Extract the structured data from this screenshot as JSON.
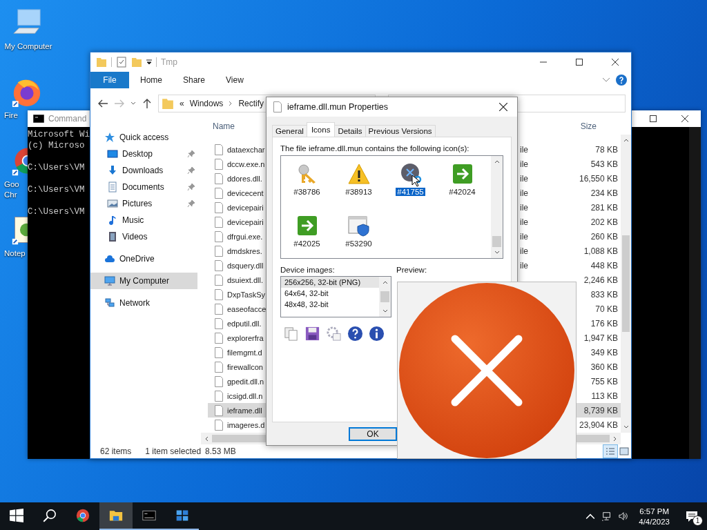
{
  "desktop_icons": [
    {
      "kind": "computer",
      "lines": [
        "My Computer"
      ]
    },
    {
      "kind": "firefox",
      "lines": [
        "Fire"
      ]
    },
    {
      "kind": "chrome",
      "lines": [
        "Goo",
        "Chr"
      ]
    },
    {
      "kind": "notepad",
      "lines": [
        "Notep"
      ]
    }
  ],
  "command_prompt": {
    "title": "Command",
    "lines": [
      {
        "kind": "banner",
        "text": "Microsoft Wi"
      },
      {
        "kind": "banner",
        "text": "(c) Microso"
      },
      {
        "kind": "prompt",
        "text": "C:\\Users\\VM"
      },
      {
        "kind": "prompt",
        "text": "C:\\Users\\VM"
      },
      {
        "kind": "prompt",
        "text": "C:\\Users\\VM"
      }
    ]
  },
  "explorer": {
    "title": "Tmp",
    "ribbon_tabs": [
      {
        "label": "File",
        "kind": "file_menu"
      },
      {
        "label": "Home",
        "kind": "tab"
      },
      {
        "label": "Share",
        "kind": "tab"
      },
      {
        "label": "View",
        "kind": "tab"
      }
    ],
    "address": {
      "overflow": "«",
      "crumbs": [
        "Windows",
        "Rectify"
      ]
    },
    "nav": [
      {
        "label": "Quick access",
        "kind": "star",
        "selected": false,
        "children": [
          {
            "label": "Desktop",
            "kind": "desktop",
            "pinned": true,
            "selected": false
          },
          {
            "label": "Downloads",
            "kind": "download",
            "pinned": true,
            "selected": false
          },
          {
            "label": "Documents",
            "kind": "documents",
            "pinned": true,
            "selected": false
          },
          {
            "label": "Pictures",
            "kind": "pictures",
            "pinned": true,
            "selected": false
          },
          {
            "label": "Music",
            "kind": "music",
            "pinned": false,
            "selected": false
          },
          {
            "label": "Videos",
            "kind": "videos",
            "pinned": false,
            "selected": false
          }
        ]
      },
      {
        "label": "OneDrive",
        "kind": "cloud",
        "selected": false
      },
      {
        "label": "My Computer",
        "kind": "computer",
        "selected": true
      },
      {
        "label": "Network",
        "kind": "network",
        "selected": false
      }
    ],
    "columns": {
      "name": "Name",
      "size": "Size"
    },
    "files": [
      {
        "name": "dataexchar",
        "type": "ile",
        "size": "78 KB",
        "selected": false
      },
      {
        "name": "dccw.exe.n",
        "type": "ile",
        "size": "543 KB",
        "selected": false
      },
      {
        "name": "ddores.dll.",
        "type": "ile",
        "size": "16,550 KB",
        "selected": false
      },
      {
        "name": "devicecent",
        "type": "ile",
        "size": "234 KB",
        "selected": false
      },
      {
        "name": "devicepairi",
        "type": "ile",
        "size": "281 KB",
        "selected": false
      },
      {
        "name": "devicepairi",
        "type": "ile",
        "size": "202 KB",
        "selected": false
      },
      {
        "name": "dfrgui.exe.",
        "type": "ile",
        "size": "260 KB",
        "selected": false
      },
      {
        "name": "dmdskres.",
        "type": "ile",
        "size": "1,088 KB",
        "selected": false
      },
      {
        "name": "dsquery.dll",
        "type": "ile",
        "size": "448 KB",
        "selected": false
      },
      {
        "name": "dsuiext.dll.",
        "size": "2,246 KB",
        "selected": false
      },
      {
        "name": "DxpTaskSy",
        "size": "833 KB",
        "selected": false
      },
      {
        "name": "easeofacce",
        "size": "70 KB",
        "selected": false
      },
      {
        "name": "edputil.dll.",
        "size": "176 KB",
        "selected": false
      },
      {
        "name": "explorerfra",
        "size": "1,947 KB",
        "selected": false
      },
      {
        "name": "filemgmt.d",
        "size": "349 KB",
        "selected": false
      },
      {
        "name": "firewallcon",
        "size": "360 KB",
        "selected": false
      },
      {
        "name": "gpedit.dll.n",
        "size": "755 KB",
        "selected": false
      },
      {
        "name": "icsigd.dll.n",
        "size": "113 KB",
        "selected": false
      },
      {
        "name": "ieframe.dll",
        "size": "8,739 KB",
        "selected": true
      },
      {
        "name": "imageres.d",
        "size": "23,904 KB",
        "selected": false
      }
    ],
    "status": {
      "items": "62 items",
      "selection": "1 item selected",
      "size": "8.53 MB"
    }
  },
  "properties": {
    "title": "ieframe.dll.mun Properties",
    "tabs": [
      {
        "label": "General",
        "selected": false
      },
      {
        "label": "Icons",
        "selected": true
      },
      {
        "label": "Details",
        "selected": false
      },
      {
        "label": "Previous Versions",
        "selected": false
      }
    ],
    "intro": "The file ieframe.dll.mun contains the following icon(s):",
    "icons": [
      {
        "label": "#38786",
        "kind": "key",
        "selected": false
      },
      {
        "label": "#38913",
        "kind": "warning",
        "selected": false
      },
      {
        "label": "#41755",
        "kind": "blocked",
        "selected": true
      },
      {
        "label": "#42024",
        "kind": "arrow",
        "selected": false
      },
      {
        "label": "#42025",
        "kind": "arrow",
        "selected": false
      },
      {
        "label": "#53290",
        "kind": "shield",
        "selected": false
      }
    ],
    "device_images_label": "Device images:",
    "device_images": [
      {
        "label": "256x256, 32-bit (PNG)",
        "selected": true
      },
      {
        "label": "64x64, 32-bit",
        "selected": false
      },
      {
        "label": "48x48, 32-bit",
        "selected": false
      }
    ],
    "preview_label": "Preview:",
    "ok": "OK"
  },
  "taskbar": {
    "apps": [
      {
        "kind": "chrome",
        "running": false,
        "active": false
      },
      {
        "kind": "explorer",
        "running": true,
        "active": true
      },
      {
        "kind": "terminal",
        "running": true,
        "active": false
      },
      {
        "kind": "app",
        "running": true,
        "active": false
      }
    ],
    "time": "6:57 PM",
    "date": "4/4/2023",
    "notifications": "1"
  }
}
